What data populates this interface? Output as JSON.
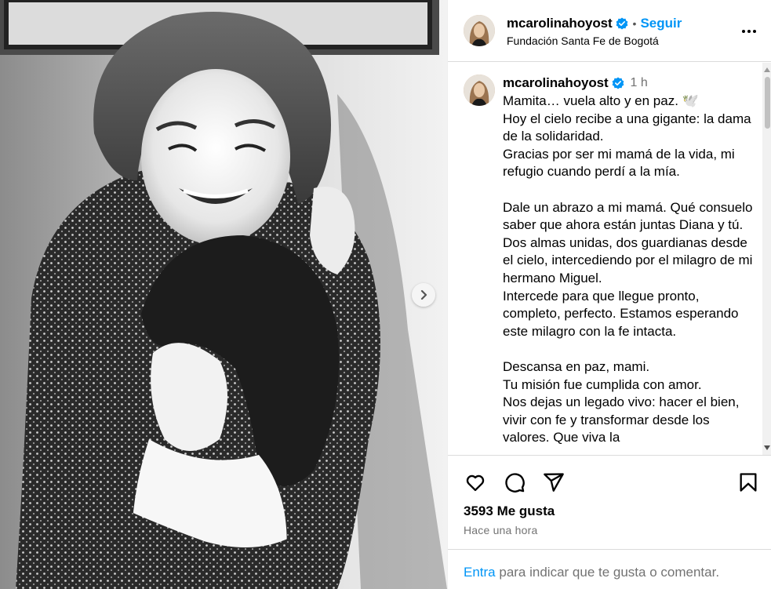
{
  "post": {
    "username": "mcarolinahoyost",
    "follow_label": "Seguir",
    "separator": "•",
    "location": "Fundación Santa Fe de Bogotá",
    "verified_icon": "verified-badge-icon",
    "more_icon": "more-options-icon"
  },
  "photo": {
    "description_icon": "black-and-white-photo",
    "next_icon": "chevron-right-icon"
  },
  "caption": {
    "username": "mcarolinahoyost",
    "time": "1 h",
    "text": "Mamita… vuela alto y en paz. 🕊️\nHoy el cielo recibe a una gigante: la dama de la solidaridad.\nGracias por ser mi mamá de la vida, mi refugio cuando perdí a la mía.\n\nDale un abrazo a mi mamá. Qué consuelo saber que ahora están juntas Diana y tú.\nDos almas unidas, dos guardianas desde el cielo, intercediendo por el milagro de mi hermano Miguel.\nIntercede para que llegue pronto, completo, perfecto. Estamos esperando este milagro con la fe intacta.\n\nDescansa en paz, mami.\nTu misión fue cumplida con amor.\nNos dejas un legado vivo: hacer el bien, vivir con fe y transformar desde los valores. Que viva la"
  },
  "actions": {
    "like_icon": "heart-icon",
    "comment_icon": "comment-icon",
    "share_icon": "share-icon",
    "save_icon": "bookmark-icon"
  },
  "stats": {
    "likes_count": "3593",
    "likes_label": "Me gusta",
    "posted_ago": "Hace una hora"
  },
  "footer": {
    "login_link": "Entra",
    "rest_text": " para indicar que te gusta o comentar."
  },
  "colors": {
    "accent": "#0095f6",
    "muted": "#737373",
    "border": "#dbdbdb"
  }
}
